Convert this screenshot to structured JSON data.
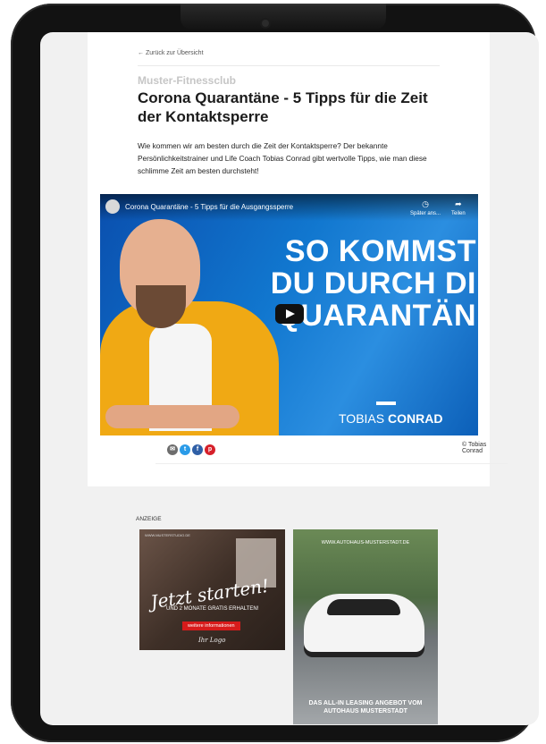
{
  "article": {
    "back_link": "← Zurück zur Übersicht",
    "club": "Muster-Fitnessclub",
    "title": "Corona Quarantäne - 5 Tipps für die Zeit der Kontaktsperre",
    "lead": "Wie kommen wir am besten durch die Zeit der Kontaktsperre? Der bekannte Persönlichkeitstrainer und Life Coach Tobias Conrad gibt wertvolle Tipps, wie man diese schlimme Zeit am besten durchsteht!",
    "copyright": "© Tobias Conrad"
  },
  "video": {
    "title": "Corona Quarantäne - 5 Tipps für die Ausgangssperre",
    "watch_later": "Später ans...",
    "share": "Teilen",
    "headline": [
      "SO KOMMST",
      "DU DURCH DI",
      "QUARANTÄN"
    ],
    "name_first": "TOBIAS ",
    "name_last": "CONRAD"
  },
  "share_icons": [
    "mail-icon",
    "twitter-icon",
    "facebook-icon",
    "pinterest-icon"
  ],
  "colors": {
    "share_mail": "#6d6d6d",
    "share_twitter": "#2a9be8",
    "share_facebook": "#2f5fa6",
    "share_pinterest": "#d6202a",
    "accent_red": "#d71b1b"
  },
  "ads": {
    "label": "ANZEIGE",
    "ad1": {
      "url": "WWW.MUSTERSTUDIO.DE",
      "headline": "Jetzt starten!",
      "subline": "UND 2 MONATE GRATIS ERHALTEN!",
      "button": "weitere informationen",
      "logo": "Ihr Logo"
    },
    "ad2": {
      "url": "WWW.AUTOHAUS-MUSTERSTADT.DE",
      "cta": "DAS ALL-IN LEASING ANGEBOT VOM AUTOHAUS MUSTERSTADT"
    }
  }
}
